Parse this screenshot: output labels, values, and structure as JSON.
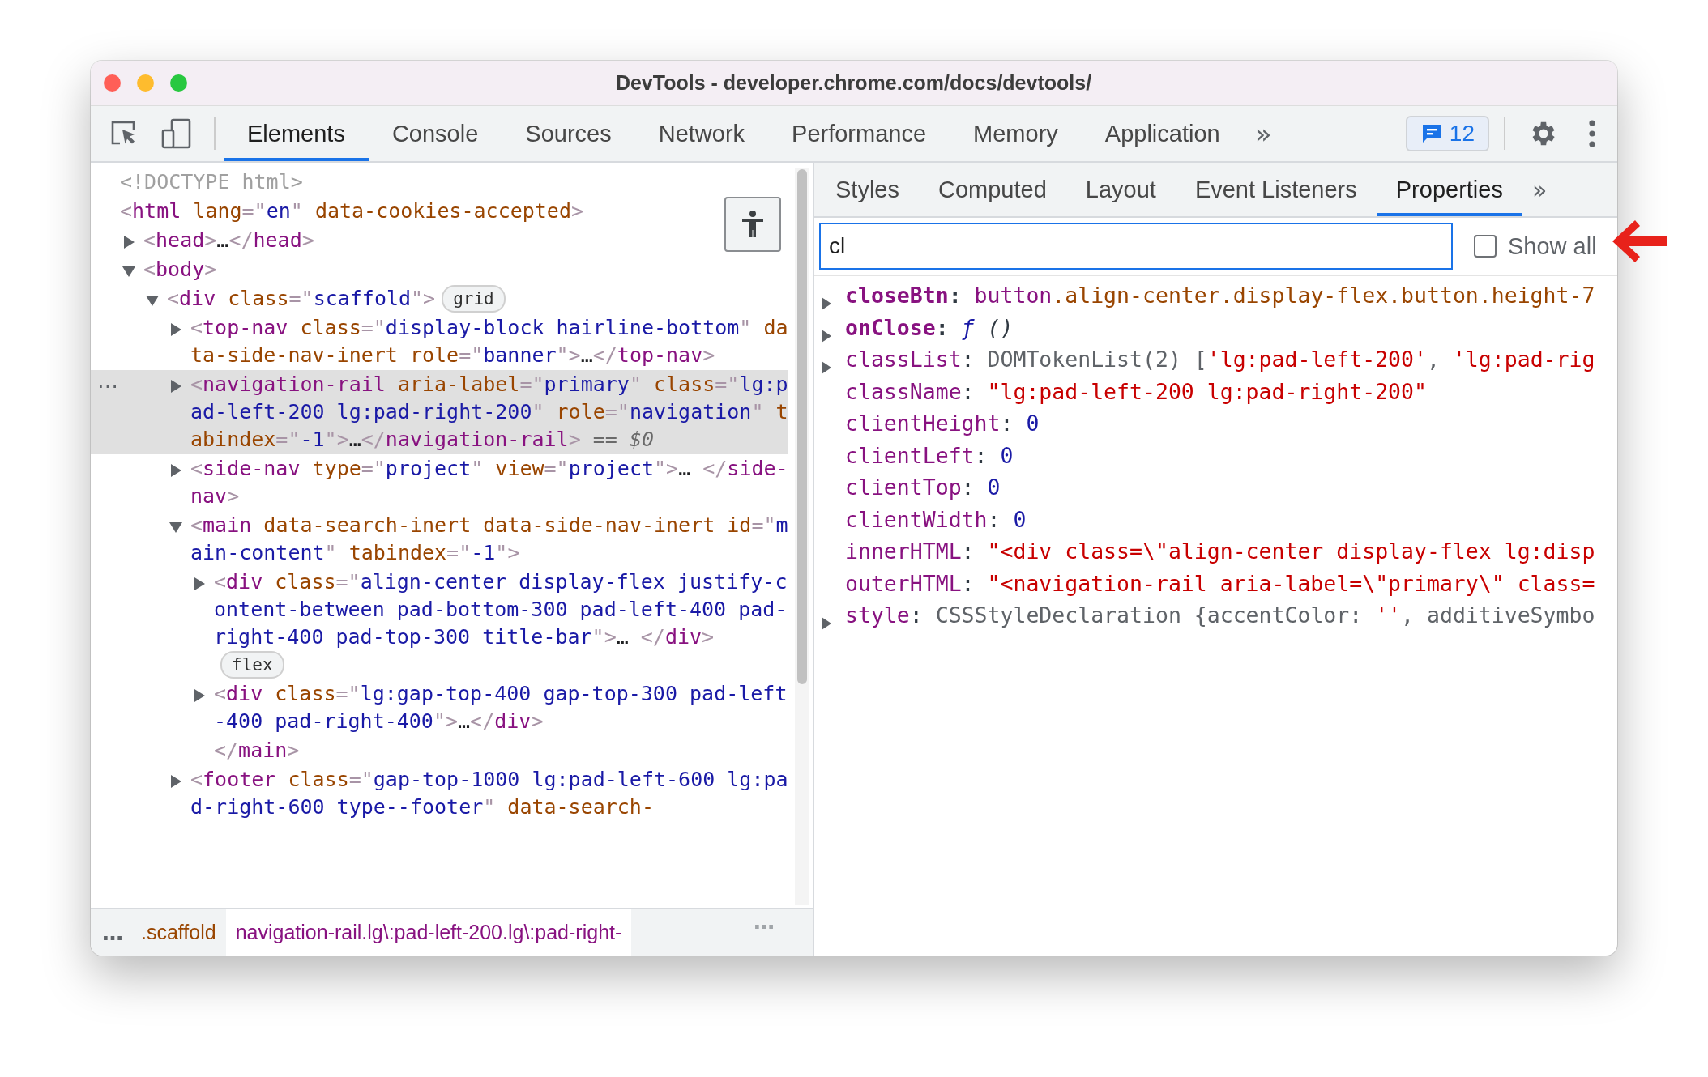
{
  "window": {
    "title": "DevTools - developer.chrome.com/docs/devtools/"
  },
  "toolbar": {
    "tabs": [
      {
        "label": "Elements",
        "selected": true
      },
      {
        "label": "Console",
        "selected": false
      },
      {
        "label": "Sources",
        "selected": false
      },
      {
        "label": "Network",
        "selected": false
      },
      {
        "label": "Performance",
        "selected": false
      },
      {
        "label": "Memory",
        "selected": false
      },
      {
        "label": "Application",
        "selected": false
      }
    ],
    "more": "»",
    "issues_count": "12"
  },
  "elements": {
    "actions_label": "…",
    "nodes": [
      {
        "tokens": [
          {
            "kind": "doctype",
            "text": "<!DOCTYPE html>"
          }
        ]
      },
      {
        "tokens": [
          {
            "kind": "punct",
            "text": "<"
          },
          {
            "kind": "tag",
            "text": "html"
          },
          {
            "kind": "attr",
            "text": " lang"
          },
          {
            "kind": "punct",
            "text": "=\""
          },
          {
            "kind": "value",
            "text": "en"
          },
          {
            "kind": "punct",
            "text": "\""
          },
          {
            "kind": "attr",
            "text": " data-cookies-accepted"
          },
          {
            "kind": "punct",
            "text": ">"
          }
        ],
        "children": [
          {
            "expanded": false,
            "selected": false,
            "tokens": [
              {
                "kind": "punct",
                "text": "<"
              },
              {
                "kind": "tag",
                "text": "head"
              },
              {
                "kind": "punct",
                "text": ">"
              },
              {
                "kind": "text",
                "text": "…"
              },
              {
                "kind": "punct",
                "text": "</"
              },
              {
                "kind": "tag",
                "text": "head"
              },
              {
                "kind": "punct",
                "text": ">"
              }
            ]
          },
          {
            "expanded": true,
            "selected": false,
            "tokens": [
              {
                "kind": "punct",
                "text": "<"
              },
              {
                "kind": "tag",
                "text": "body"
              },
              {
                "kind": "punct",
                "text": ">"
              }
            ],
            "children": [
              {
                "expanded": true,
                "selected": false,
                "badge": "grid",
                "tokens": [
                  {
                    "kind": "punct",
                    "text": "<"
                  },
                  {
                    "kind": "tag",
                    "text": "div"
                  },
                  {
                    "kind": "attr",
                    "text": " class"
                  },
                  {
                    "kind": "punct",
                    "text": "=\""
                  },
                  {
                    "kind": "value",
                    "text": "scaffold"
                  },
                  {
                    "kind": "punct",
                    "text": "\">"
                  }
                ],
                "children": [
                  {
                    "expanded": false,
                    "selected": false,
                    "tokens": [
                      {
                        "kind": "punct",
                        "text": "<"
                      },
                      {
                        "kind": "tag",
                        "text": "top-nav"
                      },
                      {
                        "kind": "attr",
                        "text": " class"
                      },
                      {
                        "kind": "punct",
                        "text": "=\""
                      },
                      {
                        "kind": "value",
                        "text": "display-block hairline-bottom"
                      },
                      {
                        "kind": "punct",
                        "text": "\""
                      },
                      {
                        "kind": "attr",
                        "text": " data-side-nav-inert"
                      },
                      {
                        "kind": "attr",
                        "text": " role"
                      },
                      {
                        "kind": "punct",
                        "text": "=\""
                      },
                      {
                        "kind": "value",
                        "text": "banner"
                      },
                      {
                        "kind": "punct",
                        "text": "\">"
                      },
                      {
                        "kind": "text",
                        "text": "…"
                      },
                      {
                        "kind": "punct",
                        "text": "</"
                      },
                      {
                        "kind": "tag",
                        "text": "top-nav"
                      },
                      {
                        "kind": "punct",
                        "text": ">"
                      }
                    ]
                  },
                  {
                    "expanded": false,
                    "selected": true,
                    "tokens": [
                      {
                        "kind": "punct",
                        "text": "<"
                      },
                      {
                        "kind": "tag",
                        "text": "navigation-rail"
                      },
                      {
                        "kind": "attr",
                        "text": " aria-label"
                      },
                      {
                        "kind": "punct",
                        "text": "=\""
                      },
                      {
                        "kind": "value",
                        "text": "primary"
                      },
                      {
                        "kind": "punct",
                        "text": "\""
                      },
                      {
                        "kind": "attr",
                        "text": " class"
                      },
                      {
                        "kind": "punct",
                        "text": "=\""
                      },
                      {
                        "kind": "value",
                        "text": "lg:pad-left-200 lg:pad-right-200"
                      },
                      {
                        "kind": "punct",
                        "text": "\""
                      },
                      {
                        "kind": "attr",
                        "text": " role"
                      },
                      {
                        "kind": "punct",
                        "text": "=\""
                      },
                      {
                        "kind": "value",
                        "text": "navigation"
                      },
                      {
                        "kind": "punct",
                        "text": "\""
                      },
                      {
                        "kind": "attr",
                        "text": " tabindex"
                      },
                      {
                        "kind": "punct",
                        "text": "=\""
                      },
                      {
                        "kind": "value",
                        "text": "-1"
                      },
                      {
                        "kind": "punct",
                        "text": "\">"
                      },
                      {
                        "kind": "text",
                        "text": "…"
                      },
                      {
                        "kind": "punct",
                        "text": "</"
                      },
                      {
                        "kind": "tag",
                        "text": "navigation-rail"
                      },
                      {
                        "kind": "punct",
                        "text": ">"
                      },
                      {
                        "kind": "ref",
                        "text": " == $0"
                      }
                    ]
                  },
                  {
                    "expanded": false,
                    "selected": false,
                    "tokens": [
                      {
                        "kind": "punct",
                        "text": "<"
                      },
                      {
                        "kind": "tag",
                        "text": "side-nav"
                      },
                      {
                        "kind": "attr",
                        "text": " type"
                      },
                      {
                        "kind": "punct",
                        "text": "=\""
                      },
                      {
                        "kind": "value",
                        "text": "project"
                      },
                      {
                        "kind": "punct",
                        "text": "\""
                      },
                      {
                        "kind": "attr",
                        "text": " view"
                      },
                      {
                        "kind": "punct",
                        "text": "=\""
                      },
                      {
                        "kind": "value",
                        "text": "project"
                      },
                      {
                        "kind": "punct",
                        "text": "\">"
                      },
                      {
                        "kind": "text",
                        "text": "… "
                      },
                      {
                        "kind": "punct",
                        "text": "</"
                      },
                      {
                        "kind": "tag",
                        "text": "side-nav"
                      },
                      {
                        "kind": "punct",
                        "text": ">"
                      }
                    ]
                  },
                  {
                    "expanded": true,
                    "selected": false,
                    "tokens": [
                      {
                        "kind": "punct",
                        "text": "<"
                      },
                      {
                        "kind": "tag",
                        "text": "main"
                      },
                      {
                        "kind": "attr",
                        "text": " data-search-inert"
                      },
                      {
                        "kind": "attr",
                        "text": " data-side-nav-inert"
                      },
                      {
                        "kind": "attr",
                        "text": " id"
                      },
                      {
                        "kind": "punct",
                        "text": "=\""
                      },
                      {
                        "kind": "value",
                        "text": "main-content"
                      },
                      {
                        "kind": "punct",
                        "text": "\""
                      },
                      {
                        "kind": "attr",
                        "text": " tabindex"
                      },
                      {
                        "kind": "punct",
                        "text": "=\""
                      },
                      {
                        "kind": "value",
                        "text": "-1"
                      },
                      {
                        "kind": "punct",
                        "text": "\">"
                      }
                    ],
                    "children": [
                      {
                        "expanded": false,
                        "selected": false,
                        "badge": "flex",
                        "tokens": [
                          {
                            "kind": "punct",
                            "text": "<"
                          },
                          {
                            "kind": "tag",
                            "text": "div"
                          },
                          {
                            "kind": "attr",
                            "text": " class"
                          },
                          {
                            "kind": "punct",
                            "text": "=\""
                          },
                          {
                            "kind": "value",
                            "text": "align-center display-flex justify-content-between pad-bottom-300 pad-left-400 pad-right-400 pad-top-300 title-bar"
                          },
                          {
                            "kind": "punct",
                            "text": "\">"
                          },
                          {
                            "kind": "text",
                            "text": "… "
                          },
                          {
                            "kind": "punct",
                            "text": "</"
                          },
                          {
                            "kind": "tag",
                            "text": "div"
                          },
                          {
                            "kind": "punct",
                            "text": ">"
                          }
                        ]
                      },
                      {
                        "expanded": false,
                        "selected": false,
                        "tokens": [
                          {
                            "kind": "punct",
                            "text": "<"
                          },
                          {
                            "kind": "tag",
                            "text": "div"
                          },
                          {
                            "kind": "attr",
                            "text": " class"
                          },
                          {
                            "kind": "punct",
                            "text": "=\""
                          },
                          {
                            "kind": "value",
                            "text": "lg:gap-top-400 gap-top-300 pad-left-400 pad-right-400"
                          },
                          {
                            "kind": "punct",
                            "text": "\">"
                          },
                          {
                            "kind": "text",
                            "text": "…"
                          },
                          {
                            "kind": "punct",
                            "text": "</"
                          },
                          {
                            "kind": "tag",
                            "text": "div"
                          },
                          {
                            "kind": "punct",
                            "text": ">"
                          }
                        ]
                      },
                      {
                        "tokens": [
                          {
                            "kind": "punct",
                            "text": "</"
                          },
                          {
                            "kind": "tag",
                            "text": "main"
                          },
                          {
                            "kind": "punct",
                            "text": ">"
                          }
                        ]
                      }
                    ]
                  },
                  {
                    "expanded": false,
                    "selected": false,
                    "tokens": [
                      {
                        "kind": "punct",
                        "text": "<"
                      },
                      {
                        "kind": "tag",
                        "text": "footer"
                      },
                      {
                        "kind": "attr",
                        "text": " class"
                      },
                      {
                        "kind": "punct",
                        "text": "=\""
                      },
                      {
                        "kind": "value",
                        "text": "gap-top-1000 lg:pad-left-600 lg:pad-right-600 type--footer"
                      },
                      {
                        "kind": "punct",
                        "text": "\""
                      },
                      {
                        "kind": "attr",
                        "text": " data-search-"
                      }
                    ]
                  }
                ]
              }
            ]
          }
        ]
      }
    ]
  },
  "breadcrumbs": {
    "scroll_left": "…",
    "items": [
      {
        "label": ".scaffold",
        "selected": false
      },
      {
        "label": "navigation-rail.lg\\:pad-left-200.lg\\:pad-right-",
        "selected": true
      }
    ],
    "scroll_right": "…"
  },
  "sidebar": {
    "tabs": [
      {
        "label": "Styles",
        "selected": false
      },
      {
        "label": "Computed",
        "selected": false
      },
      {
        "label": "Layout",
        "selected": false
      },
      {
        "label": "Event Listeners",
        "selected": false
      },
      {
        "label": "Properties",
        "selected": true
      }
    ],
    "more": "»",
    "filter": {
      "value": "cl"
    },
    "show_all": {
      "label": "Show all",
      "checked": false
    },
    "properties": [
      {
        "name": "closeBtn",
        "own": true,
        "expandable": true,
        "value": [
          {
            "kind": "punct",
            "text": ": "
          },
          {
            "kind": "element",
            "text": "button"
          },
          {
            "kind": "selector",
            "text": ".align-center.display-flex.button.height-7"
          }
        ]
      },
      {
        "name": "onClose",
        "own": true,
        "expandable": true,
        "value": [
          {
            "kind": "punct",
            "text": ": "
          },
          {
            "kind": "function",
            "text": "ƒ"
          },
          {
            "kind": "signature",
            "text": " ()"
          }
        ]
      },
      {
        "name": "classList",
        "own": false,
        "expandable": true,
        "value": [
          {
            "kind": "punct",
            "text": ": "
          },
          {
            "kind": "object",
            "text": "DOMTokenList(2) ["
          },
          {
            "kind": "string",
            "text": "'lg:pad-left-200'"
          },
          {
            "kind": "object",
            "text": ", "
          },
          {
            "kind": "string",
            "text": "'lg:pad-rig"
          }
        ]
      },
      {
        "name": "className",
        "own": false,
        "expandable": false,
        "value": [
          {
            "kind": "punct",
            "text": ": "
          },
          {
            "kind": "string",
            "text": "\"lg:pad-left-200 lg:pad-right-200\""
          }
        ]
      },
      {
        "name": "clientHeight",
        "own": false,
        "expandable": false,
        "value": [
          {
            "kind": "punct",
            "text": ": "
          },
          {
            "kind": "number",
            "text": "0"
          }
        ]
      },
      {
        "name": "clientLeft",
        "own": false,
        "expandable": false,
        "value": [
          {
            "kind": "punct",
            "text": ": "
          },
          {
            "kind": "number",
            "text": "0"
          }
        ]
      },
      {
        "name": "clientTop",
        "own": false,
        "expandable": false,
        "value": [
          {
            "kind": "punct",
            "text": ": "
          },
          {
            "kind": "number",
            "text": "0"
          }
        ]
      },
      {
        "name": "clientWidth",
        "own": false,
        "expandable": false,
        "value": [
          {
            "kind": "punct",
            "text": ": "
          },
          {
            "kind": "number",
            "text": "0"
          }
        ]
      },
      {
        "name": "innerHTML",
        "own": false,
        "expandable": false,
        "value": [
          {
            "kind": "punct",
            "text": ": "
          },
          {
            "kind": "string",
            "text": "\"<div class=\\\"align-center display-flex lg:disp"
          }
        ]
      },
      {
        "name": "outerHTML",
        "own": false,
        "expandable": false,
        "value": [
          {
            "kind": "punct",
            "text": ": "
          },
          {
            "kind": "string",
            "text": "\"<navigation-rail aria-label=\\\"primary\\\" class="
          }
        ]
      },
      {
        "name": "style",
        "own": false,
        "expandable": true,
        "value": [
          {
            "kind": "punct",
            "text": ": "
          },
          {
            "kind": "object",
            "text": "CSSStyleDeclaration {accentColor: "
          },
          {
            "kind": "string",
            "text": "''"
          },
          {
            "kind": "object",
            "text": ", additiveSymbo"
          }
        ]
      }
    ]
  }
}
